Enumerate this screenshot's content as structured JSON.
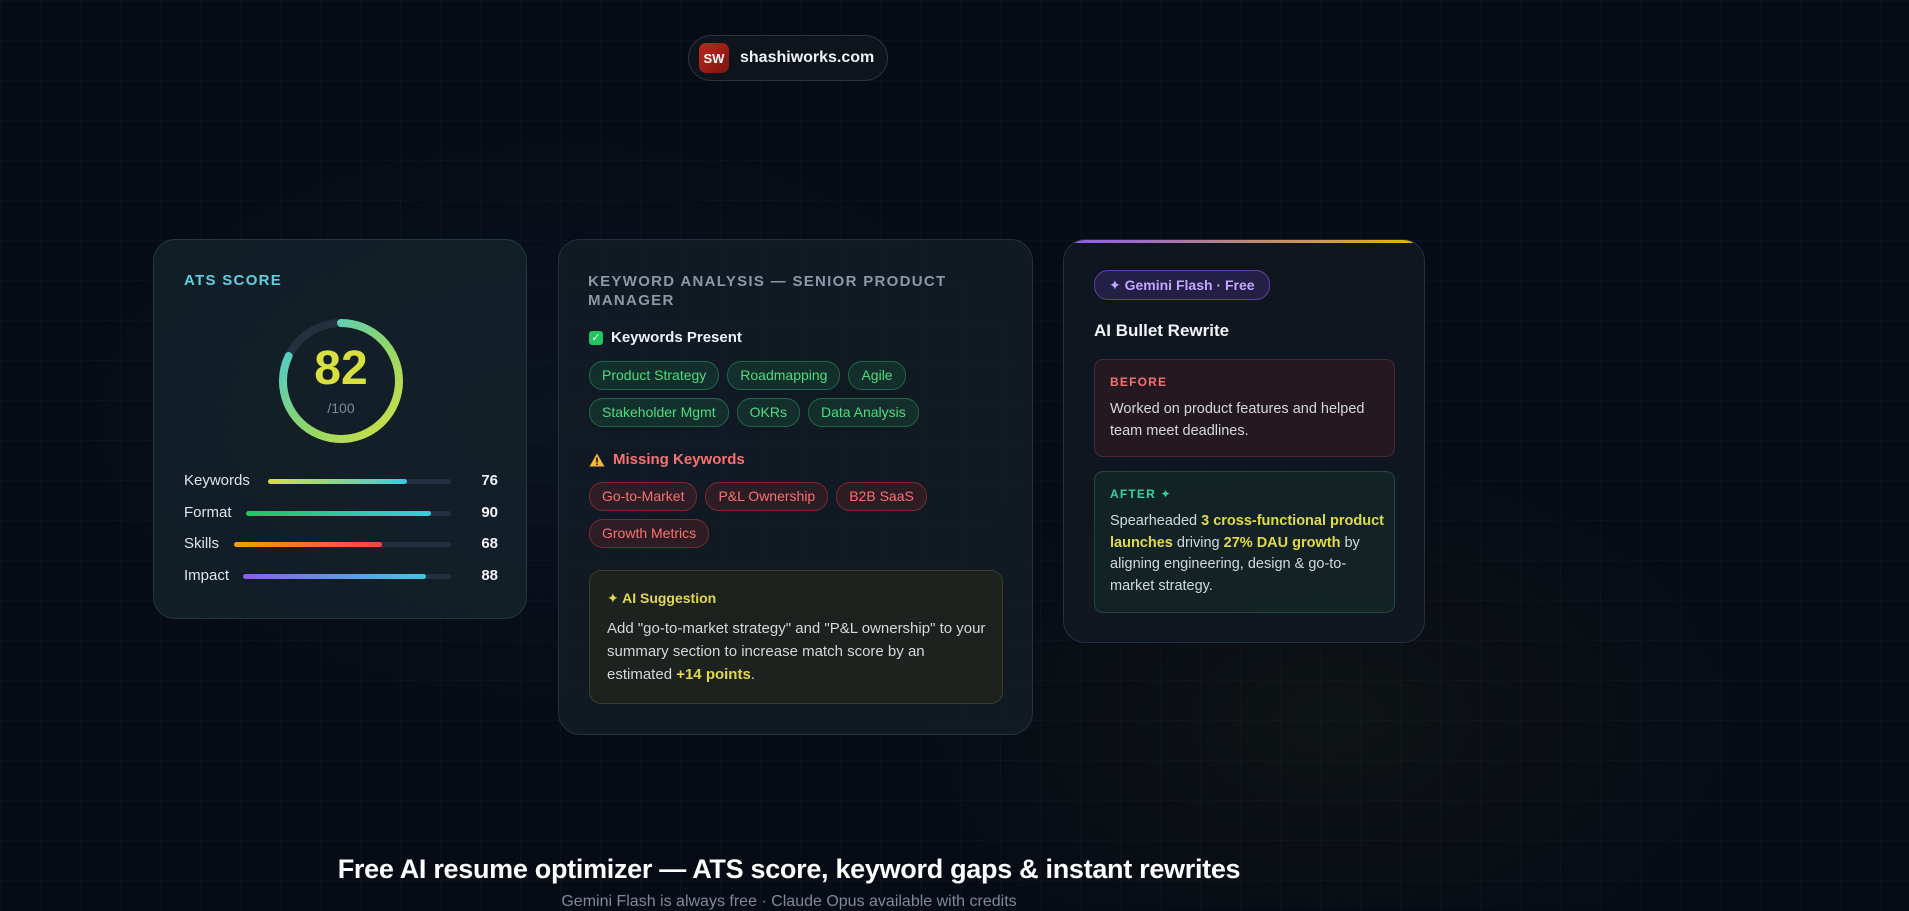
{
  "header": {
    "logo_text": "SW",
    "domain": "shashiworks.com"
  },
  "ats": {
    "heading": "ATS SCORE",
    "score": "82",
    "score_max": "/100",
    "score_value": 82,
    "metrics": [
      {
        "label": "Keywords",
        "value": "76",
        "fraction": 0.76
      },
      {
        "label": "Format",
        "value": "90",
        "fraction": 0.9
      },
      {
        "label": "Skills",
        "value": "68",
        "fraction": 0.68
      },
      {
        "label": "Impact",
        "value": "88",
        "fraction": 0.88
      }
    ]
  },
  "keywords": {
    "heading": "KEYWORD ANALYSIS — SENIOR PRODUCT MANAGER",
    "present_heading": "Keywords Present",
    "present_tags": [
      "Product Strategy",
      "Roadmapping",
      "Agile",
      "Stakeholder Mgmt",
      "OKRs",
      "Data Analysis"
    ],
    "missing_heading": "Missing Keywords",
    "missing_tags": [
      "Go-to-Market",
      "P&L Ownership",
      "B2B SaaS",
      "Growth Metrics"
    ],
    "suggestion": {
      "title": "✦ AI Suggestion",
      "text_before": "Add \"go-to-market strategy\" and \"P&L ownership\" to your summary section to increase match score by an estimated ",
      "highlight": "+14 points",
      "text_after": "."
    }
  },
  "rewrite": {
    "badge": "✦ Gemini Flash · Free",
    "title": "AI Bullet Rewrite",
    "before_label": "BEFORE",
    "before_text": "Worked on product features and helped team meet deadlines.",
    "after_label": "AFTER ✦",
    "after_parts": [
      {
        "text": "Spearheaded ",
        "hl": false
      },
      {
        "text": "3 cross-functional product launches",
        "hl": true
      },
      {
        "text": " driving ",
        "hl": false
      },
      {
        "text": "27% DAU growth",
        "hl": true
      },
      {
        "text": " by aligning engineering, design & go-to-market strategy.",
        "hl": false
      }
    ]
  },
  "footer": {
    "headline": "Free AI resume optimizer — ATS score, keyword gaps & instant rewrites",
    "subline": "Gemini Flash is always free · Claude Opus available with credits"
  },
  "colors": {
    "accent_cyan": "#5fd0e0",
    "accent_yellow": "#d8e040",
    "success": "#4ade80",
    "danger": "#f87171",
    "purple": "#8b5cf6"
  }
}
